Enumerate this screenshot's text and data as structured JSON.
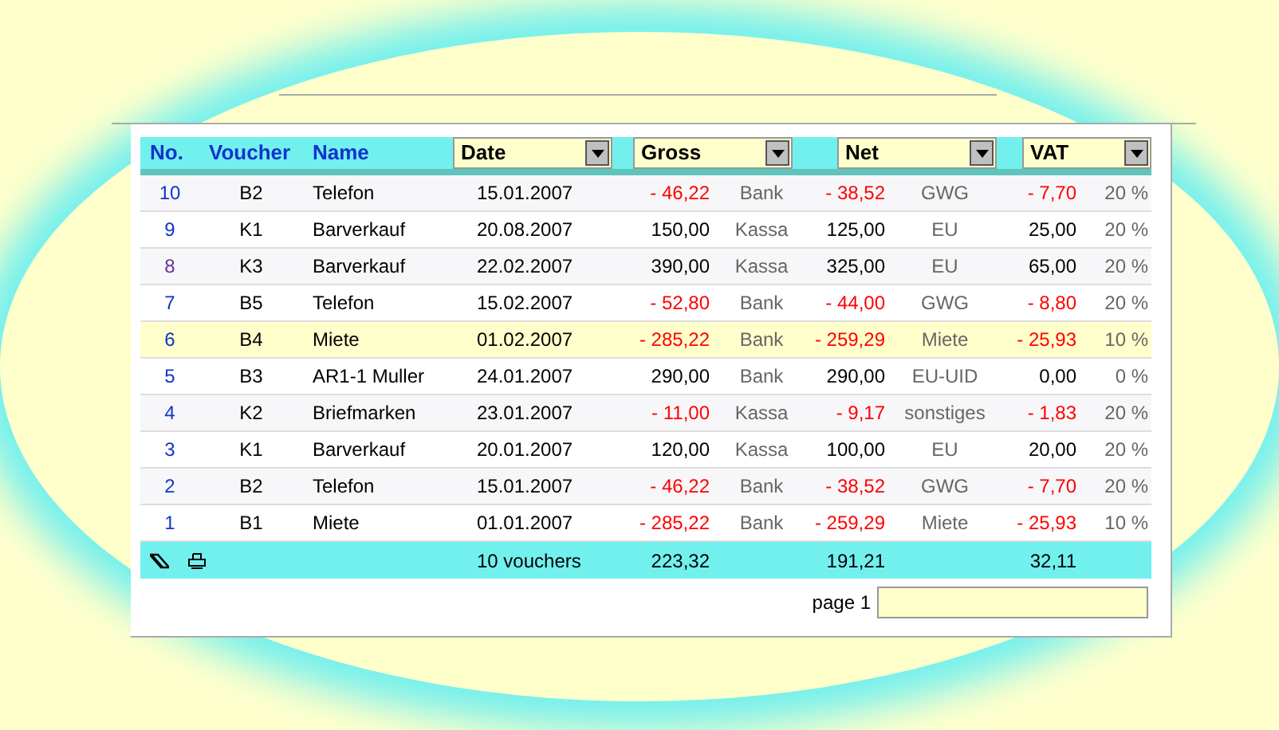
{
  "columns": [
    {
      "label": "No.",
      "kind": "plain"
    },
    {
      "label": "Voucher",
      "kind": "plain"
    },
    {
      "label": "Name",
      "kind": "plain"
    },
    {
      "label": "Date",
      "kind": "dropdown"
    },
    {
      "label": "Gross",
      "kind": "dropdown"
    },
    {
      "label": "Net",
      "kind": "dropdown"
    },
    {
      "label": "VAT",
      "kind": "dropdown"
    }
  ],
  "rows": [
    {
      "no": "10",
      "voucher": "B2",
      "name": "Telefon",
      "date": "15.01.2007",
      "gross": "- 46,22",
      "account": "Bank",
      "net": "- 38,52",
      "category": "GWG",
      "vat": "- 7,70",
      "rate": "20 %",
      "negative": true,
      "visited": false,
      "selected": false
    },
    {
      "no": "9",
      "voucher": "K1",
      "name": "Barverkauf",
      "date": "20.08.2007",
      "gross": "150,00",
      "account": "Kassa",
      "net": "125,00",
      "category": "EU",
      "vat": "25,00",
      "rate": "20 %",
      "negative": false,
      "visited": false,
      "selected": false
    },
    {
      "no": "8",
      "voucher": "K3",
      "name": "Barverkauf",
      "date": "22.02.2007",
      "gross": "390,00",
      "account": "Kassa",
      "net": "325,00",
      "category": "EU",
      "vat": "65,00",
      "rate": "20 %",
      "negative": false,
      "visited": true,
      "selected": false
    },
    {
      "no": "7",
      "voucher": "B5",
      "name": "Telefon",
      "date": "15.02.2007",
      "gross": "- 52,80",
      "account": "Bank",
      "net": "- 44,00",
      "category": "GWG",
      "vat": "- 8,80",
      "rate": "20 %",
      "negative": true,
      "visited": false,
      "selected": false
    },
    {
      "no": "6",
      "voucher": "B4",
      "name": "Miete",
      "date": "01.02.2007",
      "gross": "- 285,22",
      "account": "Bank",
      "net": "- 259,29",
      "category": "Miete",
      "vat": "- 25,93",
      "rate": "10 %",
      "negative": true,
      "visited": false,
      "selected": true
    },
    {
      "no": "5",
      "voucher": "B3",
      "name": "AR1-1 Muller",
      "date": "24.01.2007",
      "gross": "290,00",
      "account": "Bank",
      "net": "290,00",
      "category": "EU-UID",
      "vat": "0,00",
      "rate": "0 %",
      "negative": false,
      "visited": false,
      "selected": false
    },
    {
      "no": "4",
      "voucher": "K2",
      "name": "Briefmarken",
      "date": "23.01.2007",
      "gross": "- 11,00",
      "account": "Kassa",
      "net": "- 9,17",
      "category": "sonstiges",
      "vat": "- 1,83",
      "rate": "20 %",
      "negative": true,
      "visited": false,
      "selected": false
    },
    {
      "no": "3",
      "voucher": "K1",
      "name": "Barverkauf",
      "date": "20.01.2007",
      "gross": "120,00",
      "account": "Kassa",
      "net": "100,00",
      "category": "EU",
      "vat": "20,00",
      "rate": "20 %",
      "negative": false,
      "visited": false,
      "selected": false
    },
    {
      "no": "2",
      "voucher": "B2",
      "name": "Telefon",
      "date": "15.01.2007",
      "gross": "- 46,22",
      "account": "Bank",
      "net": "- 38,52",
      "category": "GWG",
      "vat": "- 7,70",
      "rate": "20 %",
      "negative": true,
      "visited": false,
      "selected": false
    },
    {
      "no": "1",
      "voucher": "B1",
      "name": "Miete",
      "date": "01.01.2007",
      "gross": "- 285,22",
      "account": "Bank",
      "net": "- 259,29",
      "category": "Miete",
      "vat": "- 25,93",
      "rate": "10 %",
      "negative": true,
      "visited": false,
      "selected": false
    }
  ],
  "footer": {
    "count": "10 vouchers",
    "gross": "223,32",
    "net": "191,21",
    "vat": "32,11"
  },
  "pager": {
    "label": "page 1"
  }
}
